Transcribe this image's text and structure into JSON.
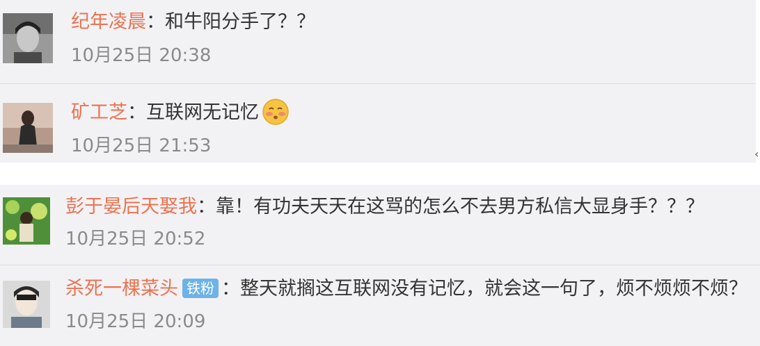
{
  "comments": [
    {
      "user": "纪年凌晨",
      "colon": "：",
      "text": "和牛阳分手了？？",
      "time": "10月25日 20:38"
    },
    {
      "user": "矿工芝",
      "colon": "：",
      "text": "互联网无记忆",
      "time": "10月25日 21:53",
      "emoji": "blushing-face-emoji"
    },
    {
      "user": "彭于晏后天娶我",
      "colon": "：",
      "text": "靠！有功夫天天在这骂的怎么不去男方私信大显身手？？？",
      "time": "10月25日 20:52"
    },
    {
      "user": "杀死一棵菜头",
      "badge": "铁粉",
      "colon": "：",
      "text": "整天就搁这互联网没有记忆，就会这一句了，烦不烦烦不烦？",
      "time": "10月25日 20:09"
    }
  ],
  "colors": {
    "card_bg": "#f2f2f5",
    "username": "#eb7350",
    "text": "#333333",
    "time": "#8a8a8a",
    "badge_bg": "#6db2e8"
  }
}
